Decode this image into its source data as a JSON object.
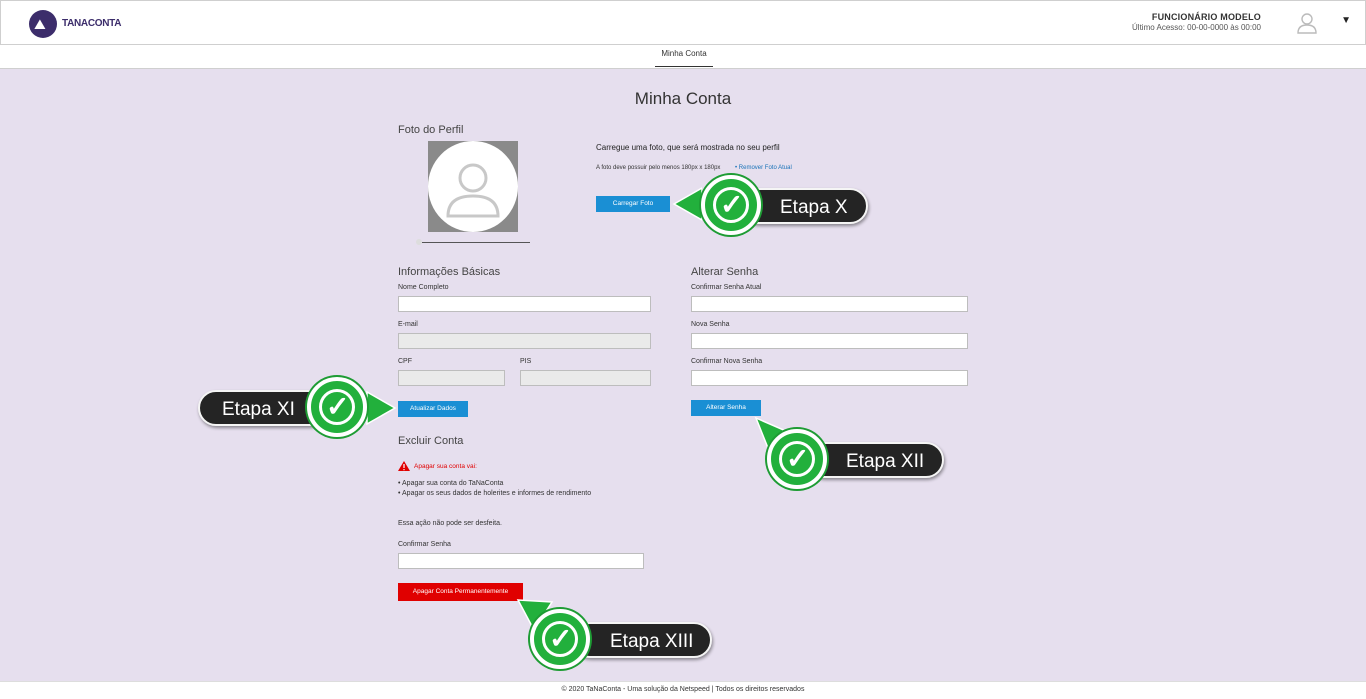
{
  "header": {
    "logo_text": "TANACONTA",
    "user_name": "FUNCIONÁRIO MODELO",
    "last_access": "Último Acesso: 00-00-0000 às 00:00",
    "caret": "▼"
  },
  "subnav": {
    "tab_label": "Minha Conta"
  },
  "page_title": "Minha Conta",
  "profile": {
    "section_title": "Foto do Perfil",
    "description": "Carregue uma foto, que será mostrada no seu perfil",
    "size_note": "A foto deve possuir pelo menos 180px x 180px",
    "remove_link": "Remover Foto Atual",
    "upload_button": "Carregar Foto"
  },
  "basic_info": {
    "section_title": "Informações Básicas",
    "name_label": "Nome Completo",
    "email_label": "E-mail",
    "cpf_label": "CPF",
    "pis_label": "PIS",
    "update_button": "Atualizar Dados"
  },
  "password": {
    "section_title": "Alterar Senha",
    "current_label": "Confirmar Senha Atual",
    "new_label": "Nova Senha",
    "confirm_label": "Confirmar Nova Senha",
    "change_button": "Alterar Senha"
  },
  "delete_account": {
    "section_title": "Excluir Conta",
    "warning": "Apagar sua conta vai:",
    "bullets": [
      "• Apagar sua conta do TaNaConta",
      "• Apagar os seus dados de holerites e informes de rendimento"
    ],
    "irreversible": "Essa ação não pode ser desfeita.",
    "confirm_label": "Confirmar Senha",
    "delete_button": "Apagar Conta Permanentemente"
  },
  "callouts": {
    "x": "Etapa X",
    "xi": "Etapa XI",
    "xii": "Etapa XII",
    "xiii": "Etapa XIII"
  },
  "footer": "© 2020 TaNaConta - Uma solução da Netspeed | Todos os direitos reservados",
  "colors": {
    "background": "#e6dfee",
    "primary_button": "#1a8fd4",
    "danger_button": "#e00000",
    "callout_check": "#22b03c",
    "callout_label": "#242424"
  }
}
